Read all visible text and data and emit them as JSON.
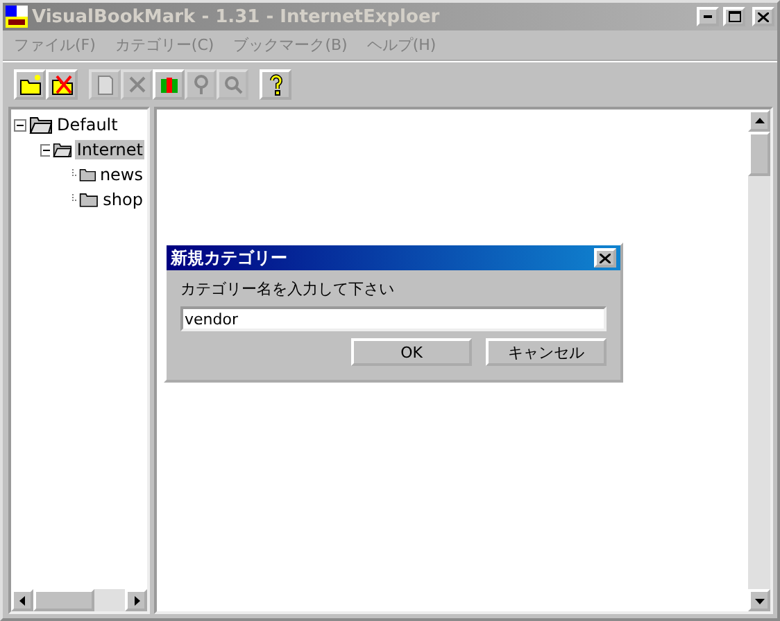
{
  "window": {
    "title": "VisualBookMark - 1.31 - InternetExploer",
    "active": false
  },
  "menu": [
    {
      "label": "ファイル(F)"
    },
    {
      "label": "カテゴリー(C)"
    },
    {
      "label": "ブックマーク(B)"
    },
    {
      "label": "ヘルプ(H)"
    }
  ],
  "toolbar": [
    {
      "kind": "new-folder",
      "disabled": false
    },
    {
      "kind": "delete-folder",
      "disabled": false
    },
    {
      "kind": "edit",
      "disabled": true
    },
    {
      "kind": "cut",
      "disabled": true
    },
    {
      "kind": "books",
      "disabled": false
    },
    {
      "kind": "tool",
      "disabled": true
    },
    {
      "kind": "zoom",
      "disabled": true
    },
    {
      "kind": "help",
      "disabled": false
    }
  ],
  "tree": [
    {
      "label": "Default",
      "expanded": true,
      "selected": false,
      "children": [
        {
          "label": "Internet",
          "expanded": true,
          "selected": true,
          "children": [
            {
              "label": "news",
              "selected": false
            },
            {
              "label": "shop",
              "selected": false
            }
          ]
        }
      ]
    }
  ],
  "dialog": {
    "title": "新規カテゴリー",
    "prompt": "カテゴリー名を入力して下さい",
    "value": "vendor",
    "buttons": [
      "OK",
      "キャンセル"
    ]
  }
}
